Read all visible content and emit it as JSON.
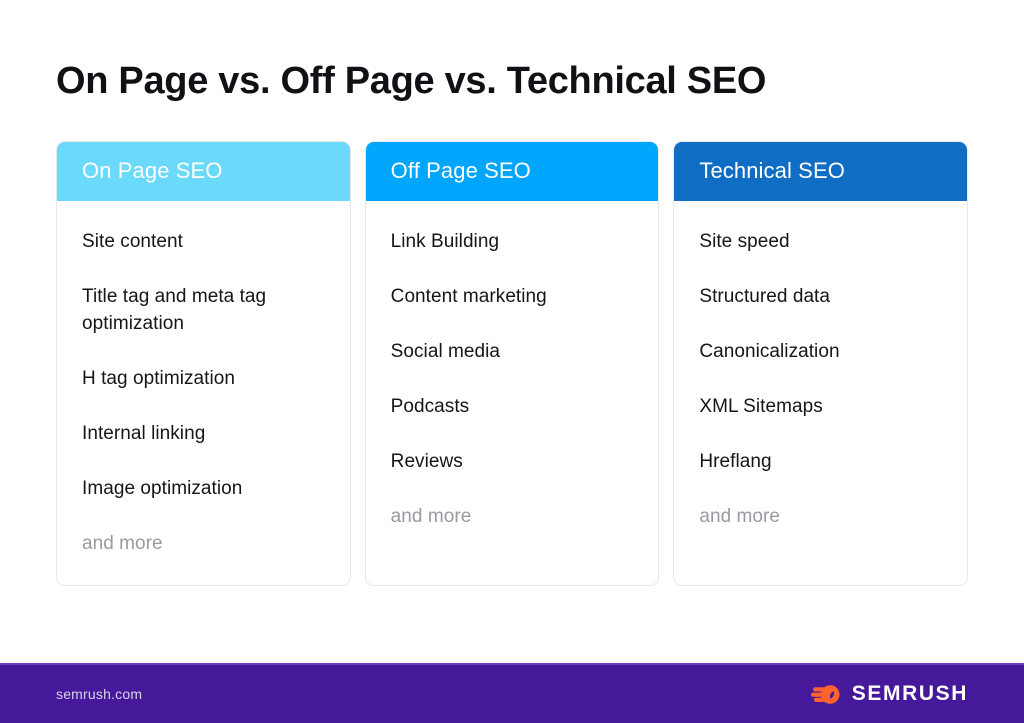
{
  "title": "On Page vs. Off Page vs. Technical SEO",
  "colors": {
    "background": "#ffffff",
    "title_text": "#111015",
    "card_border": "#e6e8ec",
    "item_text": "#16161a",
    "muted_text": "#9a9aa2",
    "footer_bg": "#46199a",
    "footer_rule": "#6a41b8",
    "footer_text": "#d9d2ec",
    "logo_mark": "#ff642d",
    "header_on_page": "#6bd9fa",
    "header_off_page": "#00a6fb",
    "header_technical": "#0f6dc4"
  },
  "columns": [
    {
      "header": "On Page SEO",
      "header_color": "#6bd9fa",
      "items": [
        "Site content",
        "Title tag and meta tag optimization",
        "H tag optimization",
        "Internal linking",
        "Image optimization"
      ],
      "more_label": "and more"
    },
    {
      "header": "Off Page SEO",
      "header_color": "#00a6fb",
      "items": [
        "Link Building",
        "Content marketing",
        "Social media",
        "Podcasts",
        "Reviews"
      ],
      "more_label": "and more"
    },
    {
      "header": "Technical SEO",
      "header_color": "#0f6dc4",
      "items": [
        "Site speed",
        "Structured data",
        "Canonicalization",
        "XML Sitemaps",
        "Hreflang"
      ],
      "more_label": "and more"
    }
  ],
  "footer": {
    "url": "semrush.com",
    "brand": "SEMRUSH",
    "logo_icon": "semrush-comet-icon"
  }
}
